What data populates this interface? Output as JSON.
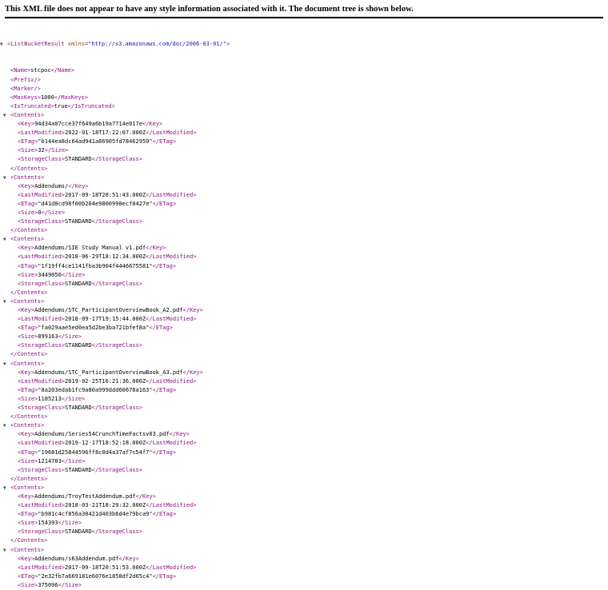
{
  "notice": "This XML file does not appear to have any style information associated with it. The document tree is shown below.",
  "toggle_glyph": "▼",
  "root": {
    "tag": "ListBucketResult",
    "attr_name": "xmlns",
    "attr_value": "\"http://s3.amazonaws.com/doc/2006-03-01/\""
  },
  "header_fields": [
    {
      "type": "pair",
      "tag": "Name",
      "value": "stcpoc"
    },
    {
      "type": "empty",
      "tag": "Prefix"
    },
    {
      "type": "empty",
      "tag": "Marker"
    },
    {
      "type": "pair",
      "tag": "MaxKeys",
      "value": "1000"
    },
    {
      "type": "pair",
      "tag": "IsTruncated",
      "value": "true"
    }
  ],
  "contents_tag": "Contents",
  "field_tags": {
    "key": "Key",
    "last_modified": "LastModified",
    "etag": "ETag",
    "size": "Size",
    "storage_class": "StorageClass"
  },
  "contents": [
    {
      "key": "94d34a07cce37f649a6b19a7714e017e",
      "last_modified": "2022-01-18T17:22:07.000Z",
      "etag": "\"b144ea8dc64ad941a86905fd78462959\"",
      "size": "32",
      "storage_class": "STANDARD"
    },
    {
      "key": "Addendums/",
      "last_modified": "2017-09-18T20:51:43.000Z",
      "etag": "\"d41d8cd98f00b204e9800998ecf8427e\"",
      "size": "0",
      "storage_class": "STANDARD"
    },
    {
      "key": "Addendums/SIE Study Manual v1.pdf",
      "last_modified": "2018-06-29T18:12:34.000Z",
      "etag": "\"1f19ff4ce1141fba3b904f4446675581\"",
      "size": "3449056",
      "storage_class": "STANDARD"
    },
    {
      "key": "Addendums/STC_ParticipantOverviewBook_A2.pdf",
      "last_modified": "2018-09-17T19:15:44.000Z",
      "etag": "\"fa029aae5ed0ea5d2be3ba721bfef8a\"",
      "size": "899163",
      "storage_class": "STANDARD"
    },
    {
      "key": "Addendums/STC_ParticipantOverviewBook_A3.pdf",
      "last_modified": "2019-02-25T16:21:36.000Z",
      "etag": "\"8a203edab1fc9a80a999ddd60678a163\"",
      "size": "1185213",
      "storage_class": "STANDARD"
    },
    {
      "key": "Addendums/Series54CrunchTimeFactsv03.pdf",
      "last_modified": "2019-12-17T18:52:18.000Z",
      "etag": "\"19681d25844596ff8c0d4a37af7c54f7\"",
      "size": "1214703",
      "storage_class": "STANDARD"
    },
    {
      "key": "Addendums/TroyTestAddendum.pdf",
      "last_modified": "2018-03-21T18:29:32.000Z",
      "etag": "\"b981c4cf856a30421d403b6d4e79bca9\"",
      "size": "154393",
      "storage_class": "STANDARD"
    },
    {
      "key": "Addendums/s63Addendum.pdf",
      "last_modified": "2017-09-18T20:51:53.000Z",
      "etag": "\"2e32fb7a669181e6076e1858df2d65c4\"",
      "size": "375096"
    }
  ]
}
